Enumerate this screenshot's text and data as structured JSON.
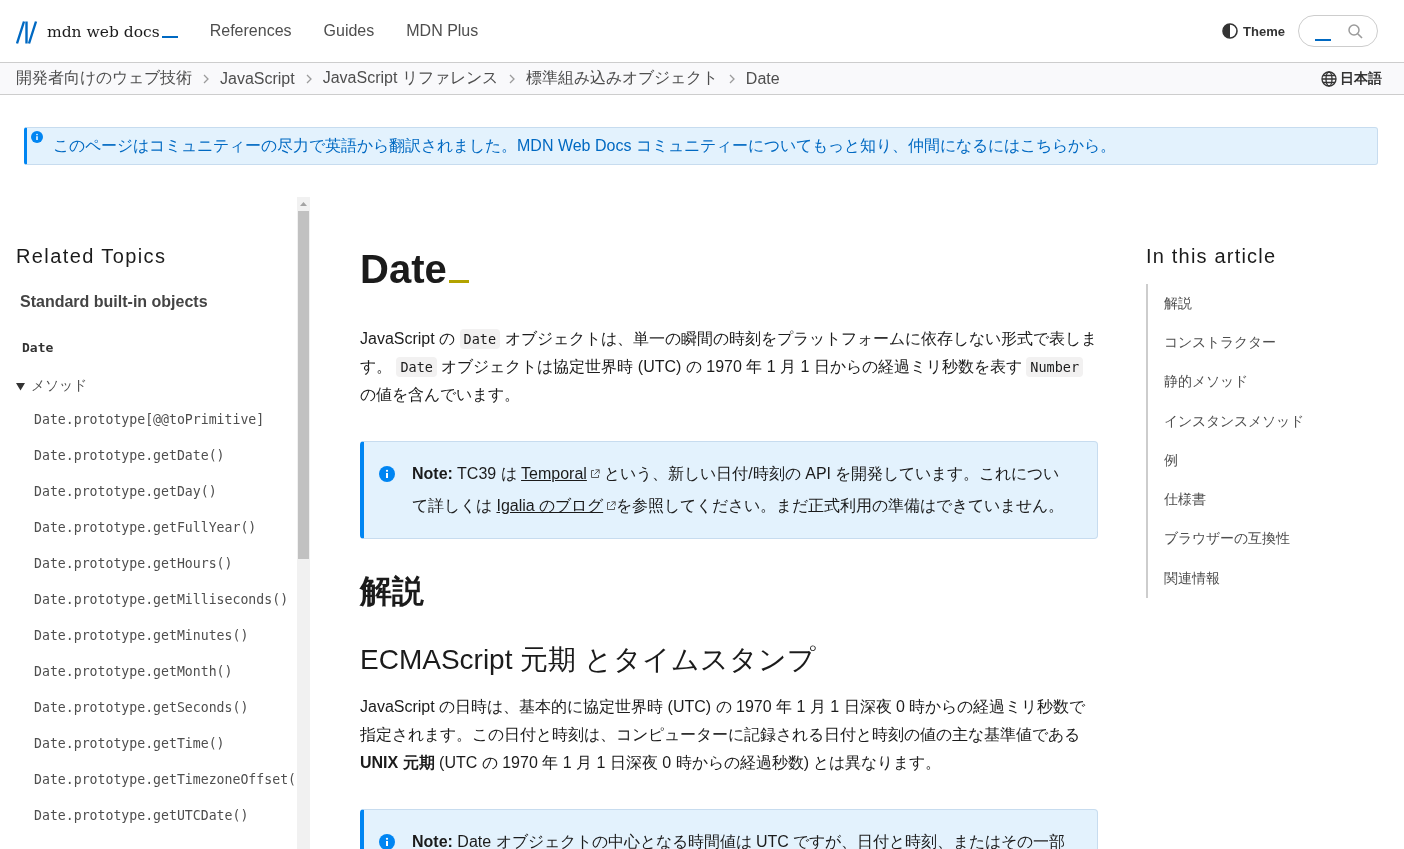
{
  "header": {
    "logo": "mdn web docs",
    "nav": [
      {
        "label": "References"
      },
      {
        "label": "Guides"
      },
      {
        "label": "MDN Plus"
      }
    ],
    "theme": "Theme"
  },
  "breadcrumbs": [
    "開発者向けのウェブ技術",
    "JavaScript",
    "JavaScript リファレンス",
    "標準組み込みオブジェクト",
    "Date"
  ],
  "language": "日本語",
  "banner": {
    "text": "このページはコミュニティーの尽力で英語から翻訳されました。MDN Web Docs コミュニティーについてもっと知り、仲間になるにはこちらから。"
  },
  "sidebar": {
    "title": "Related Topics",
    "section": "Standard built-in objects",
    "current": "Date",
    "groups": [
      {
        "label": "メソッド",
        "expanded": true,
        "items": [
          "Date.prototype[@@toPrimitive]",
          "Date.prototype.getDate()",
          "Date.prototype.getDay()",
          "Date.prototype.getFullYear()",
          "Date.prototype.getHours()",
          "Date.prototype.getMilliseconds()",
          "Date.prototype.getMinutes()",
          "Date.prototype.getMonth()",
          "Date.prototype.getSeconds()",
          "Date.prototype.getTime()",
          "Date.prototype.getTimezoneOffset(",
          "Date.prototype.getUTCDate()"
        ]
      }
    ]
  },
  "article": {
    "title": "Date",
    "blocks": [
      {
        "kind": "paragraph",
        "parts": [
          {
            "kind": "text",
            "text": "JavaScript の "
          },
          {
            "kind": "code",
            "text": "Date"
          },
          {
            "kind": "text",
            "text": " オブジェクトは、単一の瞬間の時刻をプラットフォームに依存しない形式で表します。 "
          },
          {
            "kind": "code",
            "text": "Date"
          },
          {
            "kind": "text",
            "text": " オブジェクトは協定世界時 (UTC) の 1970 年 1 月 1 日からの経過ミリ秒数を表す "
          },
          {
            "kind": "code",
            "text": "Number"
          },
          {
            "kind": "text",
            "text": " の値を含んでいます。"
          }
        ]
      },
      {
        "kind": "note",
        "parts": [
          {
            "kind": "text",
            "text": "**Note:** TC39 は "
          },
          {
            "kind": "link",
            "text": "Temporal",
            "external": true
          },
          {
            "kind": "text",
            "text": " という、新しい日付/時刻の API を開発しています。これについて詳しくは "
          },
          {
            "kind": "link",
            "text": "Igalia のブログ",
            "external": true
          },
          {
            "kind": "text",
            "text": "を参照してください。まだ正式利用の準備はできていません。"
          }
        ]
      },
      {
        "kind": "h2",
        "text": "解説"
      },
      {
        "kind": "h3",
        "text": "ECMAScript 元期 とタイムスタンプ"
      },
      {
        "kind": "paragraph",
        "parts": [
          {
            "kind": "text",
            "text": "JavaScript の日時は、基本的に協定世界時 (UTC) の 1970 年 1 月 1 日深夜 0 時からの経過ミリ秒数で指定されます。この日付と時刻は、コンピューターに記録される日付と時刻の値の主な基準値である **UNIX 元期** (UTC の 1970 年 1 月 1 日深夜 0 時からの経過秒数) とは異なります。"
          }
        ]
      },
      {
        "kind": "note",
        "parts": [
          {
            "kind": "text",
            "text": "**Note:** Date オブジェクトの中心となる時間値は UTC ですが、日付と時刻、またはその一部"
          }
        ]
      }
    ]
  },
  "toc": {
    "title": "In this article",
    "items": [
      "解説",
      "コンストラクター",
      "静的メソッド",
      "インスタンスメソッド",
      "例",
      "仕様書",
      "ブラウザーの互換性",
      "関連情報"
    ]
  }
}
